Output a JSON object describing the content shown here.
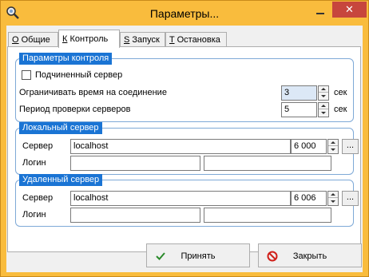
{
  "window": {
    "title": "Параметры..."
  },
  "tabs": [
    {
      "key": "О",
      "label": "Общие"
    },
    {
      "key": "К",
      "label": "Контроль"
    },
    {
      "key": "S",
      "label": "Запуск"
    },
    {
      "key": "T",
      "label": "Остановка"
    }
  ],
  "control": {
    "group_label": "Параметры контроля",
    "slave_server_label": "Подчиненный сервер",
    "slave_server_checked": false,
    "timeout_label": "Ограничивать время на соединение",
    "timeout_value": "3",
    "timeout_unit": "сек",
    "interval_label": "Период проверки серверов",
    "interval_value": "5",
    "interval_unit": "сек"
  },
  "local_server": {
    "group_label": "Локальный сервер",
    "server_label": "Сервер",
    "server_value": "localhost",
    "port_value": "6 000",
    "login_label": "Логин",
    "login_value": "",
    "password_value": "",
    "browse_label": "..."
  },
  "remote_server": {
    "group_label": "Удаленный сервер",
    "server_label": "Сервер",
    "server_value": "localhost",
    "port_value": "6 006",
    "login_label": "Логин",
    "login_value": "",
    "password_value": "",
    "browse_label": "..."
  },
  "buttons": {
    "ok_label": "Принять",
    "close_label": "Закрыть"
  },
  "colors": {
    "titlebar": "#f9bc3d",
    "group_label_bg": "#1a74d4",
    "close_button": "#c7463d",
    "ok_icon": "#2a8a2a",
    "close_icon": "#d0201a"
  }
}
